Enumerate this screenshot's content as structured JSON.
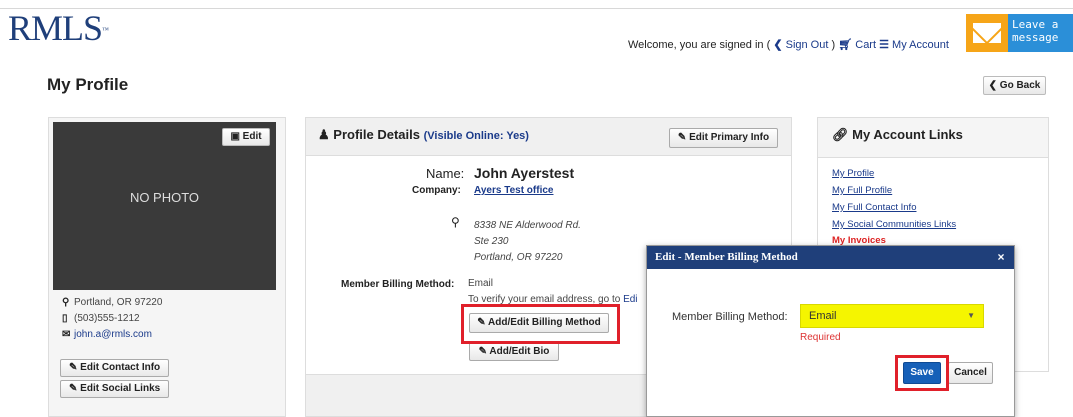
{
  "header": {
    "logo_text": "RMLS",
    "logo_mark": "™",
    "welcome": "Welcome, you are signed in (",
    "sign_out": "Sign Out",
    "close_paren": " )",
    "cart": "Cart",
    "my_account": "My Account",
    "leave_message": "Leave a\nmessage"
  },
  "page": {
    "title": "My Profile",
    "go_back": "Go Back"
  },
  "left_card": {
    "edit_photo": "Edit",
    "no_photo": "NO PHOTO",
    "location": "Portland, OR 97220",
    "phone": "(503)555-1212",
    "email": "john.a@rmls.com",
    "edit_contact": "Edit Contact Info",
    "edit_social": "Edit Social Links"
  },
  "profile_details": {
    "heading": "Profile Details",
    "visible_link": "(Visible Online: Yes)",
    "edit_primary": "Edit Primary Info",
    "name_label": "Name:",
    "name_value": "John Ayerstest",
    "company_label": "Company:",
    "company_value": "Ayers Test office",
    "address_line1": "8338 NE Alderwood Rd.",
    "address_line2": "Ste 230",
    "address_line3": "Portland, OR 97220",
    "billing_label": "Member Billing Method:",
    "billing_value": "Email",
    "verify_text": "To verify your email address, go to",
    "verify_link": "Edi",
    "add_billing": "Add/Edit Billing Method",
    "add_bio": "Add/Edit Bio"
  },
  "account_links": {
    "heading": "My Account Links",
    "links": [
      "My Profile",
      "My Full Profile",
      "My Full Contact Info",
      "My Social Communities Links",
      "My Invoices"
    ]
  },
  "modal": {
    "title": "Edit - Member Billing Method",
    "close": "×",
    "field_label": "Member Billing Method:",
    "field_value": "Email",
    "required": "Required",
    "save": "Save",
    "cancel": "Cancel"
  },
  "colors": {
    "brand": "#1f3f7a",
    "highlight": "#e0202a",
    "select_bg": "#f5f500",
    "save_bg": "#1660b8"
  }
}
